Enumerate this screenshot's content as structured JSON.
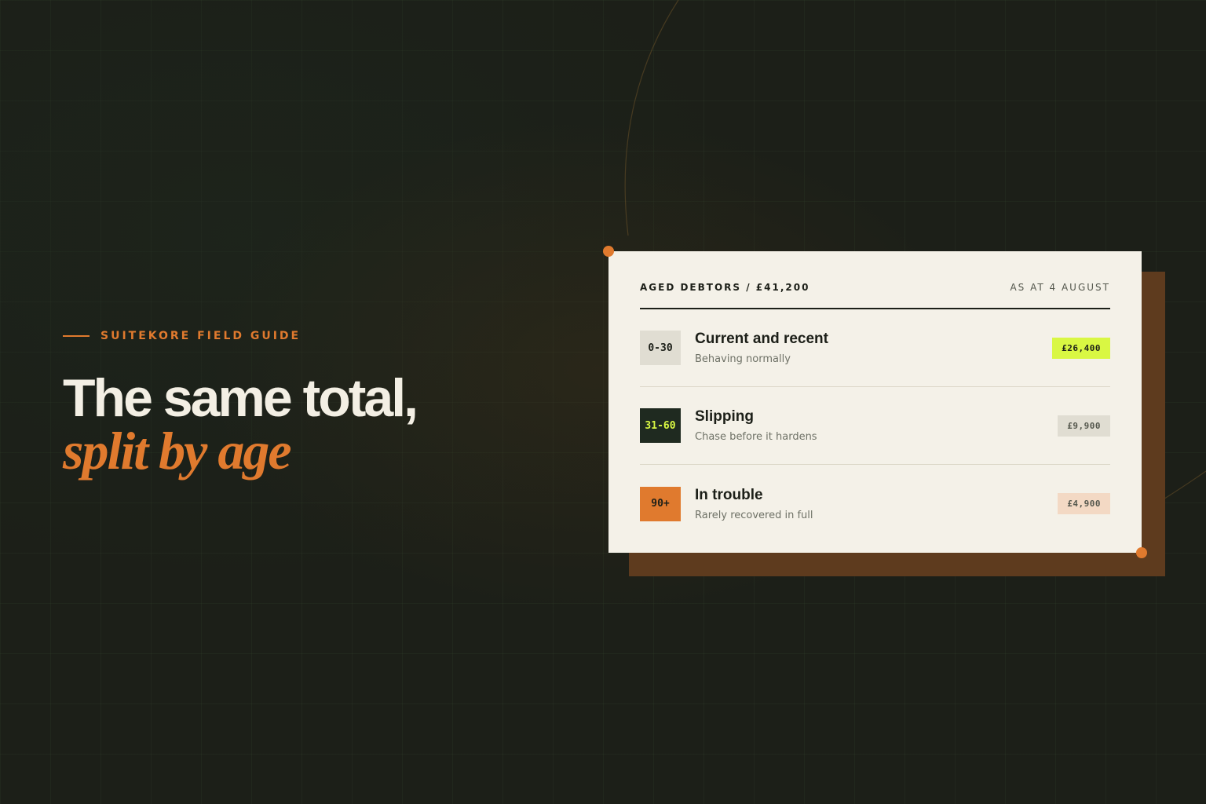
{
  "brand": {
    "eyebrow": "SUITEKORE FIELD GUIDE"
  },
  "headline": {
    "line1": "The same total,",
    "line2": "split by age"
  },
  "card": {
    "title": "AGED DEBTORS / £41,200",
    "date": "AS AT 4 AUGUST",
    "rows": [
      {
        "age": "0-30",
        "label": "Current and recent",
        "sub": "Behaving normally",
        "amount": "£26,400"
      },
      {
        "age": "31-60",
        "label": "Slipping",
        "sub": "Chase before it hardens",
        "amount": "£9,900"
      },
      {
        "age": "90+",
        "label": "In trouble",
        "sub": "Rarely recovered in full",
        "amount": "£4,900"
      }
    ]
  },
  "colors": {
    "background": "#1c1f18",
    "accent": "#e07a2e",
    "highlight": "#d9f743",
    "card": "#f4f1e8",
    "card_shadow": "#5e3b1e"
  }
}
